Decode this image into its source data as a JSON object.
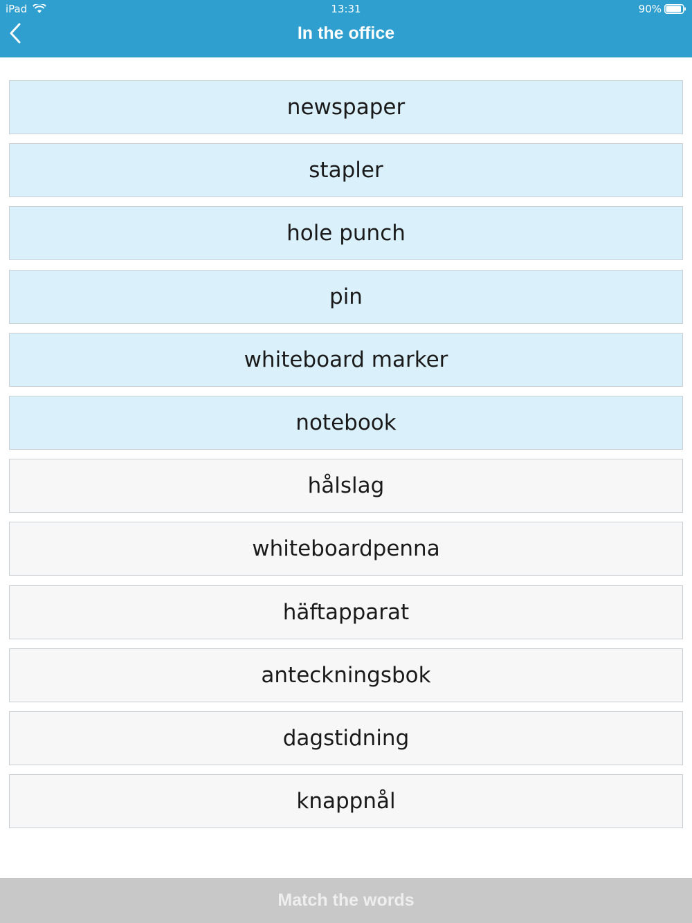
{
  "status_bar": {
    "device": "iPad",
    "time": "13:31",
    "battery": "90%"
  },
  "header": {
    "title": "In the office",
    "back_icon": "chevron-left-icon"
  },
  "english_words": [
    {
      "label": "newspaper"
    },
    {
      "label": "stapler"
    },
    {
      "label": "hole punch"
    },
    {
      "label": "pin"
    },
    {
      "label": "whiteboard marker"
    },
    {
      "label": "notebook"
    }
  ],
  "swedish_words": [
    {
      "label": "hålslag"
    },
    {
      "label": "whiteboardpenna"
    },
    {
      "label": "häftapparat"
    },
    {
      "label": "anteckningsbok"
    },
    {
      "label": "dagstidning"
    },
    {
      "label": "knappnål"
    }
  ],
  "footer": {
    "button_label": "Match the words"
  },
  "colors": {
    "header_bg": "#2e9fcf",
    "english_card_bg": "#daf0fa",
    "swedish_card_bg": "#f7f7f7",
    "footer_bg_disabled": "#c8c8c8"
  }
}
